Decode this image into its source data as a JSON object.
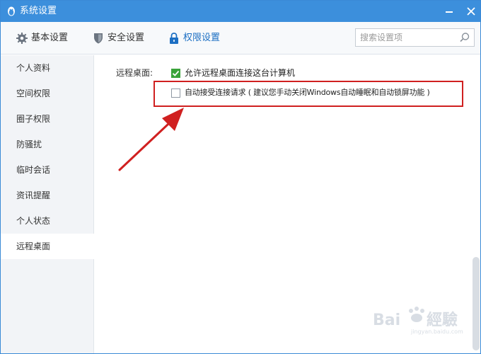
{
  "window": {
    "title": "系统设置"
  },
  "toolbar": {
    "items": [
      {
        "label": "基本设置",
        "icon": "gear-icon"
      },
      {
        "label": "安全设置",
        "icon": "shield-icon"
      },
      {
        "label": "权限设置",
        "icon": "lock-icon"
      }
    ],
    "active": "权限设置"
  },
  "search": {
    "placeholder": "搜索设置项",
    "value": ""
  },
  "sidebar": {
    "items": [
      {
        "label": "个人资料"
      },
      {
        "label": "空间权限"
      },
      {
        "label": "圈子权限"
      },
      {
        "label": "防骚扰"
      },
      {
        "label": "临时会话"
      },
      {
        "label": "资讯提醒"
      },
      {
        "label": "个人状态"
      },
      {
        "label": "远程桌面"
      }
    ],
    "active": "远程桌面"
  },
  "content": {
    "section_label": "远程桌面:",
    "options": [
      {
        "label": "允许远程桌面连接这台计算机",
        "checked": true
      },
      {
        "label": "自动接受连接请求 ( 建议您手动关闭Windows自动睡眠和自动锁屏功能 )",
        "checked": false
      }
    ]
  },
  "annotation": {
    "highlight_color": "#d02020",
    "arrow_color": "#d02020"
  },
  "colors": {
    "titlebar": "#3c8fdc",
    "accent": "#1c6fc3",
    "check": "#3aa33a"
  }
}
